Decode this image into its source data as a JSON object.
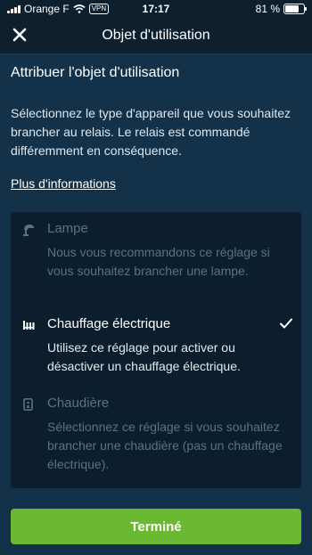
{
  "status_bar": {
    "carrier": "Orange F",
    "vpn": "VPN",
    "time": "17:17",
    "battery": "81 %",
    "battery_level": 0.81
  },
  "nav": {
    "title": "Objet d'utilisation",
    "close_icon": "close-icon"
  },
  "heading": "Attribuer l'objet d'utilisation",
  "description": "Sélectionnez le type d'appareil que vous souhaitez brancher au relais. Le relais est commandé différemment en conséquence.",
  "more_info": "Plus d'informations",
  "options": [
    {
      "icon": "lamp-icon",
      "label": "Lampe",
      "sub": "Nous vous recommandons ce réglage si vous souhaitez brancher une lampe.",
      "selected": false
    },
    {
      "icon": "heater-icon",
      "label": "Chauffage électrique",
      "sub": "Utilisez ce réglage pour activer ou désactiver un chauffage électrique.",
      "selected": true
    },
    {
      "icon": "boiler-icon",
      "label": "Chaudière",
      "sub": "Sélectionnez ce réglage si vous souhaitez brancher une chaudière (pas un chauffage électrique).",
      "selected": false
    }
  ],
  "done_button": "Terminé",
  "colors": {
    "background": "#13324a",
    "nav_background": "#0e1f2e",
    "panel": "#0c1e2d",
    "accent_green": "#6bb832",
    "dim_text": "#587286"
  }
}
